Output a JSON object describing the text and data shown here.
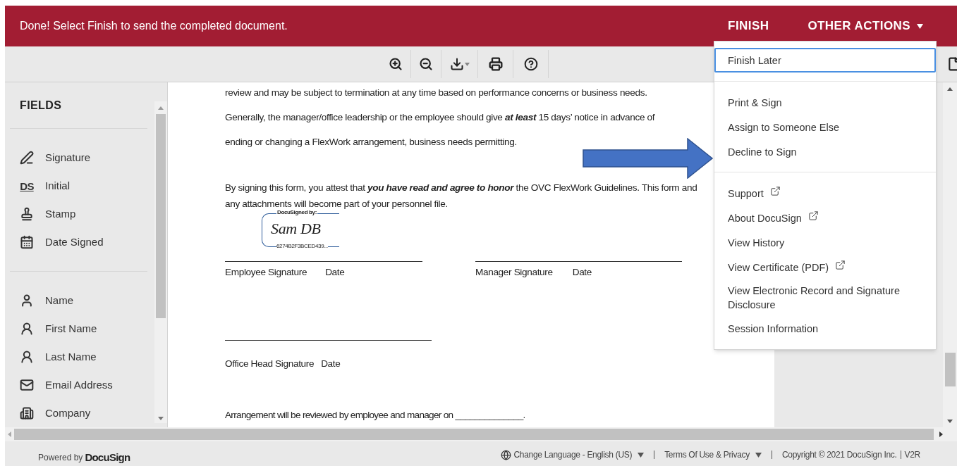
{
  "header": {
    "message": "Done! Select Finish to send the completed document.",
    "finish": "FINISH",
    "other_actions": "OTHER ACTIONS",
    "menu_open": true
  },
  "sidebar": {
    "title": "FIELDS",
    "groups": [
      [
        {
          "label": "Signature"
        },
        {
          "label": "Initial",
          "icon_text": "DS"
        },
        {
          "label": "Stamp"
        },
        {
          "label": "Date Signed"
        }
      ],
      [
        {
          "label": "Name"
        },
        {
          "label": "First Name"
        },
        {
          "label": "Last Name"
        },
        {
          "label": "Email Address"
        },
        {
          "label": "Company"
        }
      ]
    ]
  },
  "document": {
    "paragraph_1": [
      "review and may be subject to termination at any time based on performance concerns or business needs.",
      "Generally, the manager/office leadership or the employee should give **at least** 15 days’ notice in advance of",
      "ending or changing a FlexWork arrangement, business needs permitting."
    ],
    "paragraph_2": "By signing this form, you attest that **you have read and agree to honor** the OVC FlexWork Guidelines.  This form and any attachments will become part of your personnel file.",
    "signature": {
      "caption": "DocuSigned by:",
      "name": "Sam DB",
      "id": "6274B2F3BCED439..."
    },
    "employee_labels": [
      "Employee Signature",
      "Date"
    ],
    "manager_labels": [
      "Manager  Signature",
      "Date"
    ],
    "office_labels": [
      "Office Head Signature",
      "Date"
    ],
    "arrangement": "Arrangement will be reviewed by employee and manager on ______________."
  },
  "menu": {
    "groups": [
      [
        {
          "label": "Finish Later",
          "selected": true,
          "external": false
        }
      ],
      [
        {
          "label": "Print & Sign",
          "selected": false,
          "external": false
        },
        {
          "label": "Assign to Someone Else",
          "selected": false,
          "external": false
        },
        {
          "label": "Decline to Sign",
          "selected": false,
          "external": false
        }
      ],
      [
        {
          "label": "Support",
          "selected": false,
          "external": true
        },
        {
          "label": "About DocuSign",
          "selected": false,
          "external": true
        },
        {
          "label": "View History",
          "selected": false,
          "external": false
        },
        {
          "label": "View Certificate (PDF)",
          "selected": false,
          "external": true
        },
        {
          "label": "View Electronic Record and Signature Disclosure",
          "selected": false,
          "external": false
        },
        {
          "label": "Session Information",
          "selected": false,
          "external": false
        }
      ]
    ]
  },
  "footer": {
    "powered_by": "Powered by",
    "brand": "DocuSign",
    "language": "Change Language - English (US)",
    "terms": "Terms Of Use & Privacy",
    "copyright": "Copyright © 2021 DocuSign Inc.",
    "version": "V2R"
  }
}
